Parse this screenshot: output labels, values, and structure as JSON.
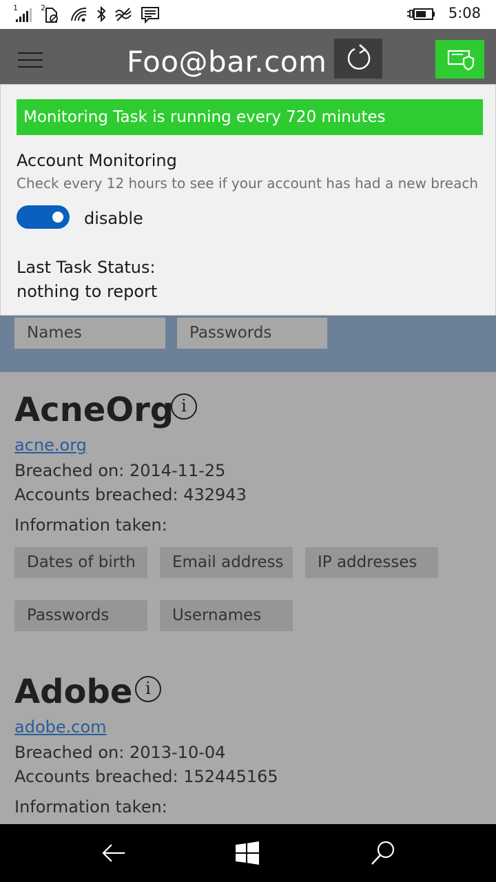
{
  "status_bar": {
    "sim1": "1",
    "sim2": "2",
    "time": "5:08",
    "icons": [
      "signal-icon",
      "sim2-icon",
      "wifi-icon",
      "bluetooth-icon",
      "data-icon",
      "message-icon",
      "battery-icon"
    ]
  },
  "header": {
    "title": "Foo@bar.com",
    "menu_icon": "hamburger-icon",
    "refresh_icon": "refresh-icon",
    "monitor_icon": "shield-monitor-icon",
    "accent": "#2ecc31"
  },
  "panel": {
    "banner": "Monitoring Task is running every 720 minutes",
    "title": "Account Monitoring",
    "subtitle": "Check every 12 hours to see if your account has had a new breach",
    "toggle_on": true,
    "toggle_label": "disable",
    "status_label": "Last Task Status:",
    "status_value": "nothing to report",
    "toggle_color": "#0a5fbf"
  },
  "filters": [
    "Names",
    "Passwords"
  ],
  "breaches": [
    {
      "name": "AcneOrg",
      "domain": "acne.org",
      "breached_on_label": "Breached on:",
      "breached_on": "2014-11-25",
      "accounts_label": "Accounts breached:",
      "accounts": "432943",
      "info_label": "Information taken:",
      "data_classes": [
        "Dates of birth",
        "Email address",
        "IP addresses",
        "Passwords",
        "Usernames"
      ]
    },
    {
      "name": "Adobe",
      "domain": "adobe.com",
      "breached_on_label": "Breached on:",
      "breached_on": "2013-10-04",
      "accounts_label": "Accounts breached:",
      "accounts": "152445165",
      "info_label": "Information taken:"
    }
  ],
  "info_glyph": "i",
  "nav": {
    "icons": [
      "back-icon",
      "windows-start-icon",
      "search-icon"
    ]
  }
}
